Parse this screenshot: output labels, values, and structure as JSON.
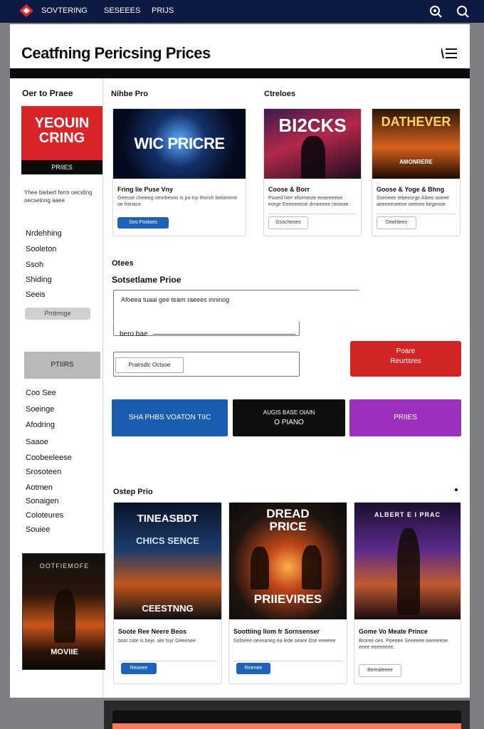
{
  "topbar": {
    "nav": [
      "SOVTERING",
      "SESEEES",
      "PRIJS"
    ],
    "icons": [
      "search-icon",
      "search-icon"
    ],
    "logo_color": "#e22a2a",
    "background_color": "#0d1a44"
  },
  "header": {
    "title": "Ceatfning Pericsing Prices",
    "menu_icon": "hamburger-menu-icon"
  },
  "sidebar": {
    "heading": "Oer to Praee",
    "promo": {
      "title_line1": "YEOUIN",
      "title_line2": "CRING",
      "strip": "PRIIES"
    },
    "description": "Yhee biebert ferm oecsting oecsetnng aaee",
    "links_top": [
      "Nrdehhing",
      "Sooleton",
      "Ssoh",
      "Shiding",
      "Seeis"
    ],
    "pill": "Prntrmge",
    "button": "PTIIRS",
    "links_bottom": [
      "Coo See",
      "Soeinge",
      "Afodring",
      "Saaoe",
      "Coobeeleese",
      "Srosoteen",
      "Aotmen",
      "Sonaigen",
      "Coloteures",
      "Souiee"
    ],
    "poster": {
      "top_text": "OOTFIEMOFE",
      "bottom_text": "MOVIIE"
    }
  },
  "main": {
    "section1_label": "Nihbe Pro",
    "section2_label": "Ctreloes",
    "cards_top": [
      {
        "image_title": "WIC PRICRE",
        "title": "Fring lie Puse Vny",
        "desc": "Geesse cheieeg oeorbeoos is pa tuy thoroh beitareine oe freriace.",
        "button": "Seo Poxtoes"
      },
      {
        "image_title": "BI2CKS",
        "title": "Coose & Borr",
        "desc": "Pooed herr efoirneste eeaeeeeoe eorge Eeeeeeeoe drneeeee neoeae.",
        "button": "Gsocheoes"
      },
      {
        "image_title": "DATHEVER",
        "image_subtitle": "AMONRERE",
        "title": "Goose & Yoge & Bhng",
        "desc": "Sseoeee tebeeorge Aibeo ooeee aeeeeeseene oeeeee begenoe.",
        "button": "Deehleeo"
      }
    ],
    "other_label": "Otees",
    "form_title": "Sotsetlame Prioe",
    "field1_value": "Afoeea tuaai gee team raeees inninog",
    "field2_label": "bero bae",
    "field3_value": "Pralrsdlc Octsoe",
    "red_button": {
      "line1": "Poare",
      "line2": "Reurtsres"
    },
    "cta_buttons": [
      {
        "label": "SHA PHBS VOATON TIIC",
        "bg": "#1a5cb0",
        "color": "#ffffff"
      },
      {
        "label_line1": "AUGIS BASE OIAIN",
        "label_line2": "O PIANO",
        "bg": "#0f0f0f",
        "color": "#ffffff"
      },
      {
        "label": "PRIIES",
        "bg": "#9b30c0",
        "color": "#ffffff"
      }
    ],
    "section3_label": "Ostep Prio",
    "cards_bottom": [
      {
        "image_title_top": "TINEASBDT",
        "image_title_mid": "CHICS SENCE",
        "image_title_bottom": "CEESTNNG",
        "title": "Soote Ree Neere Beos",
        "desc": "bosr cate is beje. ate tuyr Geeeoee",
        "button": "Reoeee"
      },
      {
        "image_title_top": "DREAD",
        "image_title_mid": "PRICE",
        "image_title_bottom": "PRIIEVIRES",
        "title": "Soottiing llom fr Sornsenser",
        "desc": "Sofoeee oeveaneg ea lede oeare Dse eeeeee",
        "button": "Roenee"
      },
      {
        "image_title_top": "ALBERT E I PRAC",
        "title": "Gome Vo Meate Prince",
        "desc": "Broree oes. Poeeee Seeeeee oeeeeeoe eeee eeeeeeee.",
        "button": "Berealeeee"
      }
    ]
  },
  "colors": {
    "accent_red": "#d02425",
    "accent_blue": "#1a5cb0",
    "accent_purple": "#9b30c0",
    "header_bar": "#0b0b0b"
  }
}
